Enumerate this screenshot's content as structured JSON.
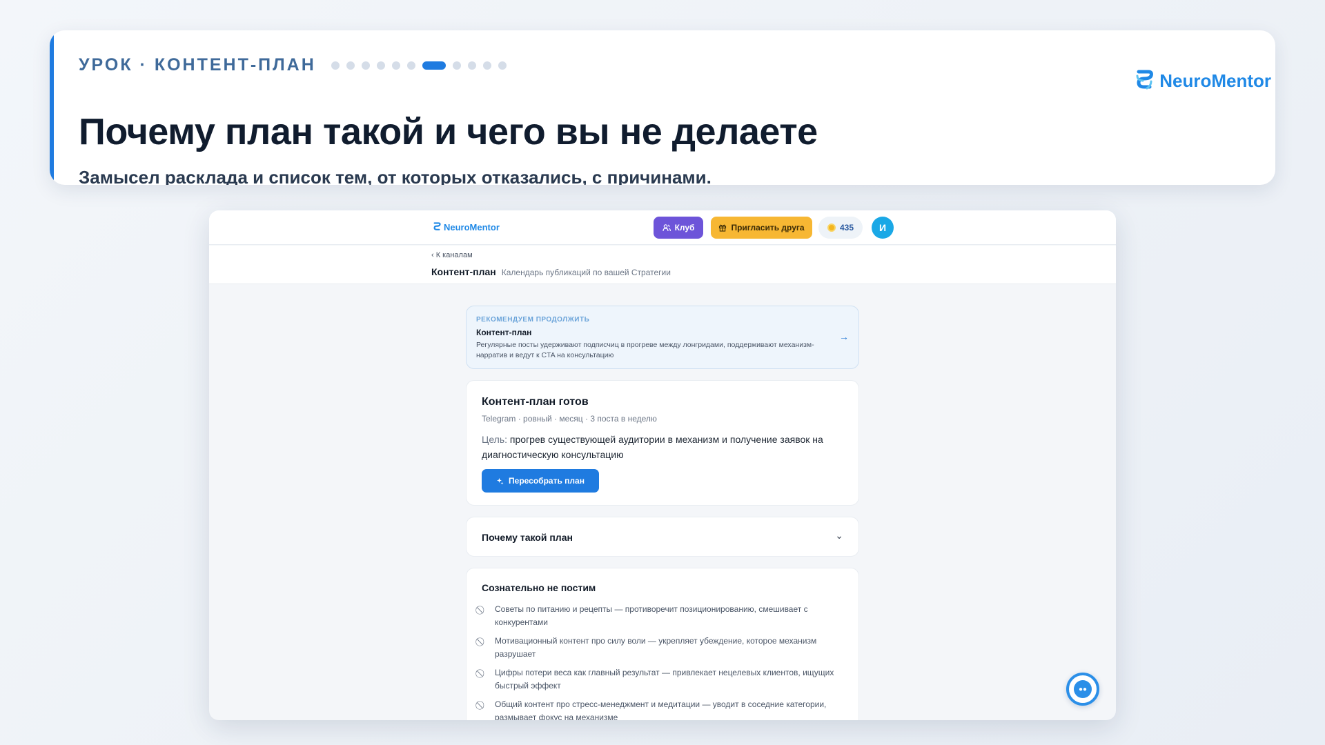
{
  "lesson": {
    "tag": "УРОК · КОНТЕНТ-ПЛАН",
    "title": "Почему план такой и чего вы не делаете",
    "subtitle": "Замысел расклада и список тем, от которых отказались, с причинами.",
    "progress": {
      "total_steps": 11,
      "current_step": 7
    },
    "brand": "NeuroMentor",
    "accent_color": "#1f7be0"
  },
  "app": {
    "brand": "NeuroMentor",
    "nav": {
      "club_label": "Клуб",
      "invite_label": "Пригласить друга",
      "coins": "435",
      "avatar_initial": "И"
    },
    "breadcrumb": {
      "back_label": "‹ К каналам"
    },
    "page": {
      "title": "Контент-план",
      "subtitle": "Календарь публикаций по вашей Стратегии"
    },
    "recommend": {
      "label": "РЕКОМЕНДУЕМ ПРОДОЛЖИТЬ",
      "title": "Контент-план",
      "text": "Регулярные посты удерживают подписчиц в прогреве между лонгридами, поддерживают механизм-нарратив и ведут к CTA на консультацию"
    },
    "ready_card": {
      "title": "Контент-план готов",
      "meta": "Telegram · ровный · месяц · 3 поста в неделю",
      "goal_label": "Цель:",
      "goal_text": "прогрев существующей аудитории в механизм и получение заявок на диагностическую консультацию",
      "rebuild_label": "Пересобрать план"
    },
    "why_card": {
      "title": "Почему такой план"
    },
    "not_posting": {
      "title": "Сознательно не постим",
      "items": [
        "Советы по питанию и рецепты — противоречит позиционированию, смешивает с конкурентами",
        "Мотивационный контент про силу воли — укрепляет убеждение, которое механизм разрушает",
        "Цифры потери веса как главный результат — привлекает нецелевых клиентов, ищущих быстрый эффект",
        "Общий контент про стресс-менеджмент и медитации — уводит в соседние категории, размывает фокус на механизме"
      ]
    }
  }
}
